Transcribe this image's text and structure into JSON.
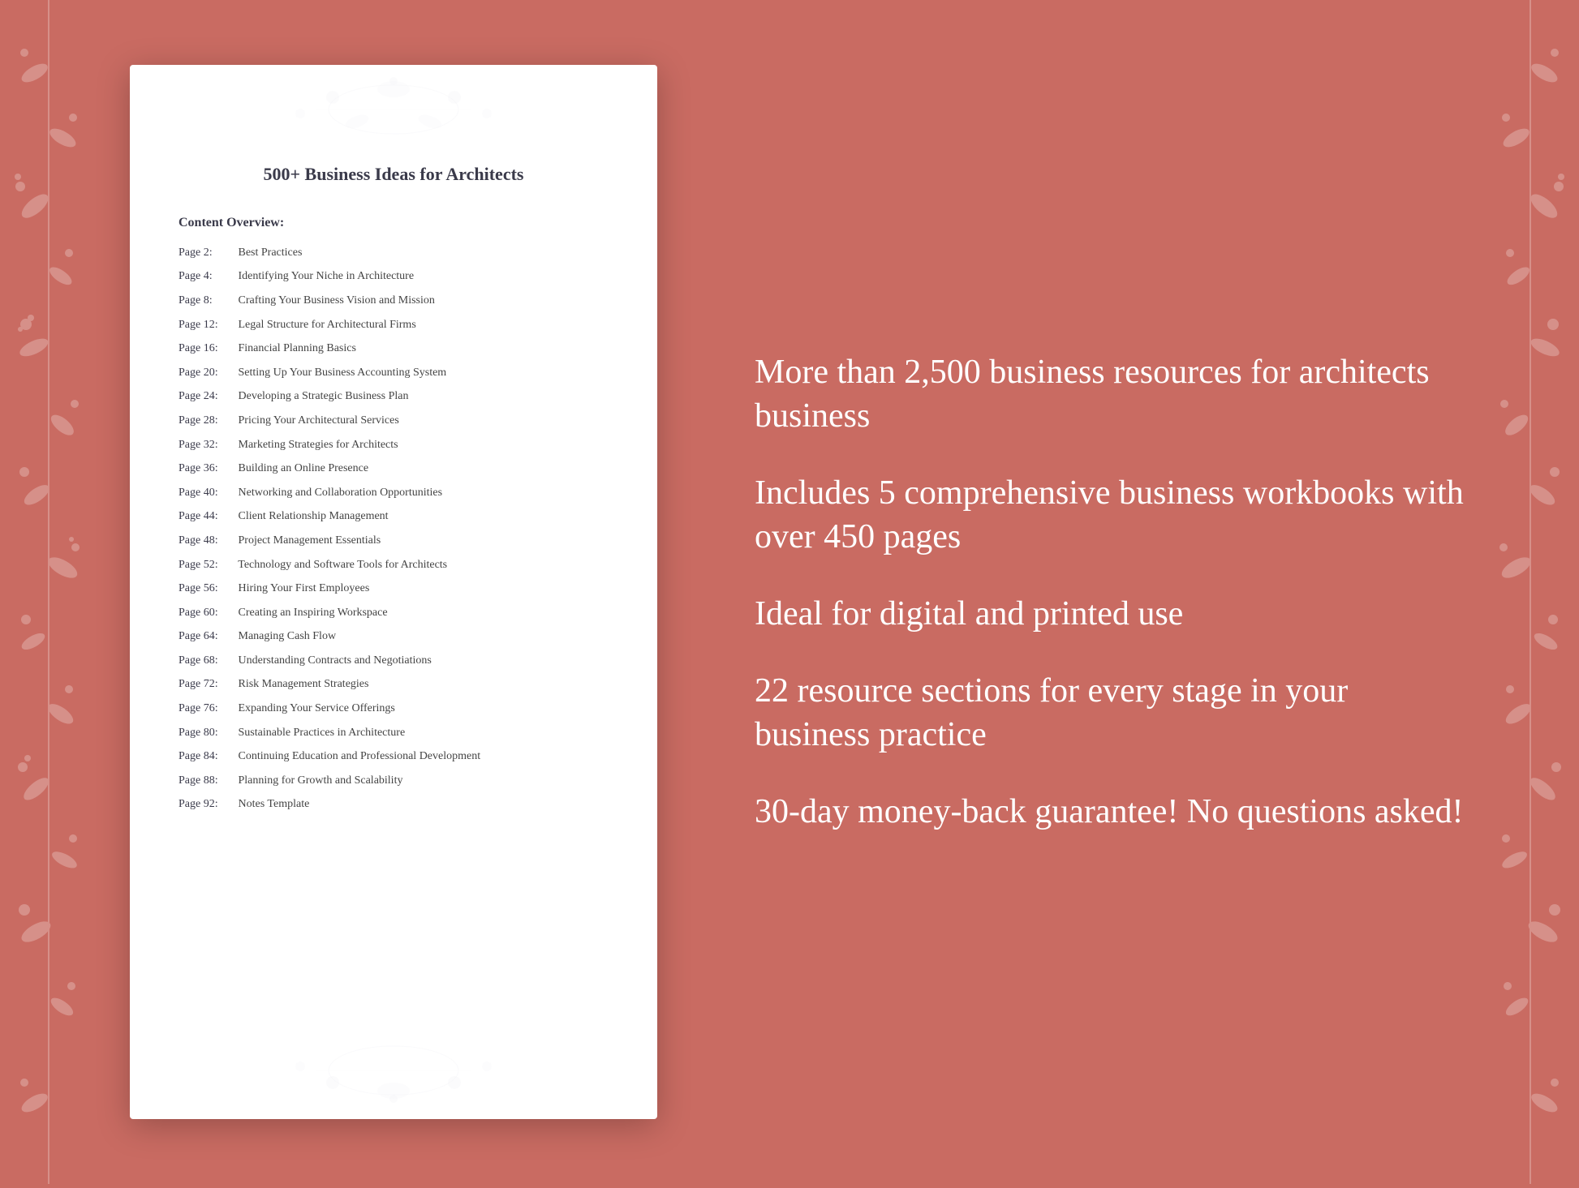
{
  "document": {
    "title": "500+ Business Ideas for Architects",
    "content_overview_label": "Content Overview:",
    "toc_items": [
      {
        "page": "Page  2:",
        "topic": "Best Practices"
      },
      {
        "page": "Page  4:",
        "topic": "Identifying Your Niche in Architecture"
      },
      {
        "page": "Page  8:",
        "topic": "Crafting Your Business Vision and Mission"
      },
      {
        "page": "Page 12:",
        "topic": "Legal Structure for Architectural Firms"
      },
      {
        "page": "Page 16:",
        "topic": "Financial Planning Basics"
      },
      {
        "page": "Page 20:",
        "topic": "Setting Up Your Business Accounting System"
      },
      {
        "page": "Page 24:",
        "topic": "Developing a Strategic Business Plan"
      },
      {
        "page": "Page 28:",
        "topic": "Pricing Your Architectural Services"
      },
      {
        "page": "Page 32:",
        "topic": "Marketing Strategies for Architects"
      },
      {
        "page": "Page 36:",
        "topic": "Building an Online Presence"
      },
      {
        "page": "Page 40:",
        "topic": "Networking and Collaboration Opportunities"
      },
      {
        "page": "Page 44:",
        "topic": "Client Relationship Management"
      },
      {
        "page": "Page 48:",
        "topic": "Project Management Essentials"
      },
      {
        "page": "Page 52:",
        "topic": "Technology and Software Tools for Architects"
      },
      {
        "page": "Page 56:",
        "topic": "Hiring Your First Employees"
      },
      {
        "page": "Page 60:",
        "topic": "Creating an Inspiring Workspace"
      },
      {
        "page": "Page 64:",
        "topic": "Managing Cash Flow"
      },
      {
        "page": "Page 68:",
        "topic": "Understanding Contracts and Negotiations"
      },
      {
        "page": "Page 72:",
        "topic": "Risk Management Strategies"
      },
      {
        "page": "Page 76:",
        "topic": "Expanding Your Service Offerings"
      },
      {
        "page": "Page 80:",
        "topic": "Sustainable Practices in Architecture"
      },
      {
        "page": "Page 84:",
        "topic": "Continuing Education and Professional Development"
      },
      {
        "page": "Page 88:",
        "topic": "Planning for Growth and Scalability"
      },
      {
        "page": "Page 92:",
        "topic": "Notes Template"
      }
    ]
  },
  "features": [
    "More than 2,500 business resources for architects business",
    "Includes 5 comprehensive business workbooks with over 450 pages",
    "Ideal for digital and printed use",
    "22 resource sections for every stage in your business practice",
    "30-day money-back guarantee! No questions asked!"
  ]
}
